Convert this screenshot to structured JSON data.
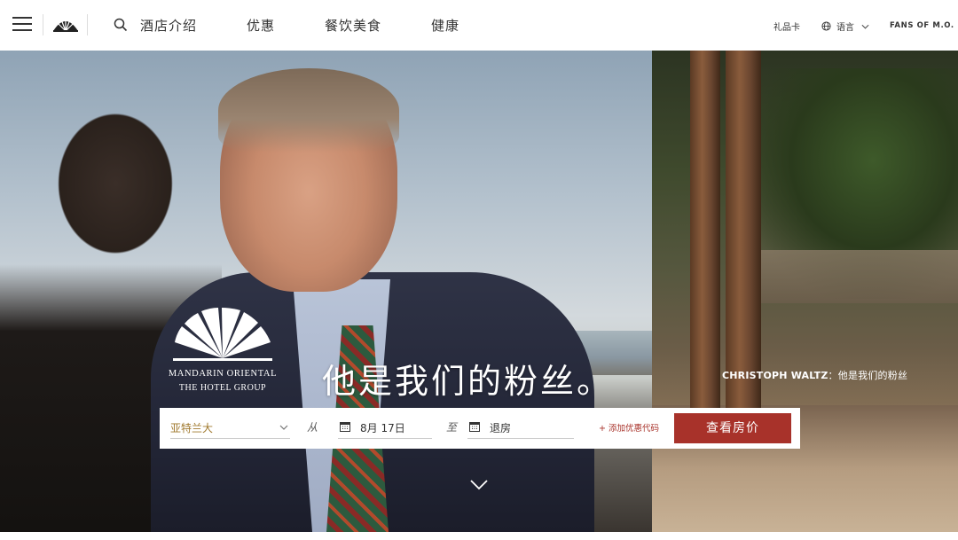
{
  "header": {
    "nav": [
      {
        "label": "酒店介绍"
      },
      {
        "label": "优惠"
      },
      {
        "label": "餐饮美食"
      },
      {
        "label": "健康"
      }
    ],
    "utility": {
      "gift_card": "礼品卡",
      "language": "语言",
      "fans": "FANS OF M.O."
    },
    "icons": [
      "hamburger-menu-icon",
      "fan-logo-icon",
      "search-icon",
      "globe-icon",
      "chevron-down-icon"
    ]
  },
  "hero": {
    "brand_line1": "MANDARIN ORIENTAL",
    "brand_line2": "THE HOTEL GROUP",
    "headline": "他是我们的粉丝。",
    "caption_name": "CHRISTOPH WALTZ",
    "caption_text": "：他是我们的粉丝"
  },
  "booking": {
    "destination": "亚特兰大",
    "from_label": "从",
    "check_in": "8月 17日",
    "to_label": "至",
    "check_out": "退房",
    "promo_label": "+ 添加优惠代码",
    "submit_label": "查看房价"
  },
  "colors": {
    "accent": "#a8322a",
    "destination_text": "#a0792e"
  }
}
